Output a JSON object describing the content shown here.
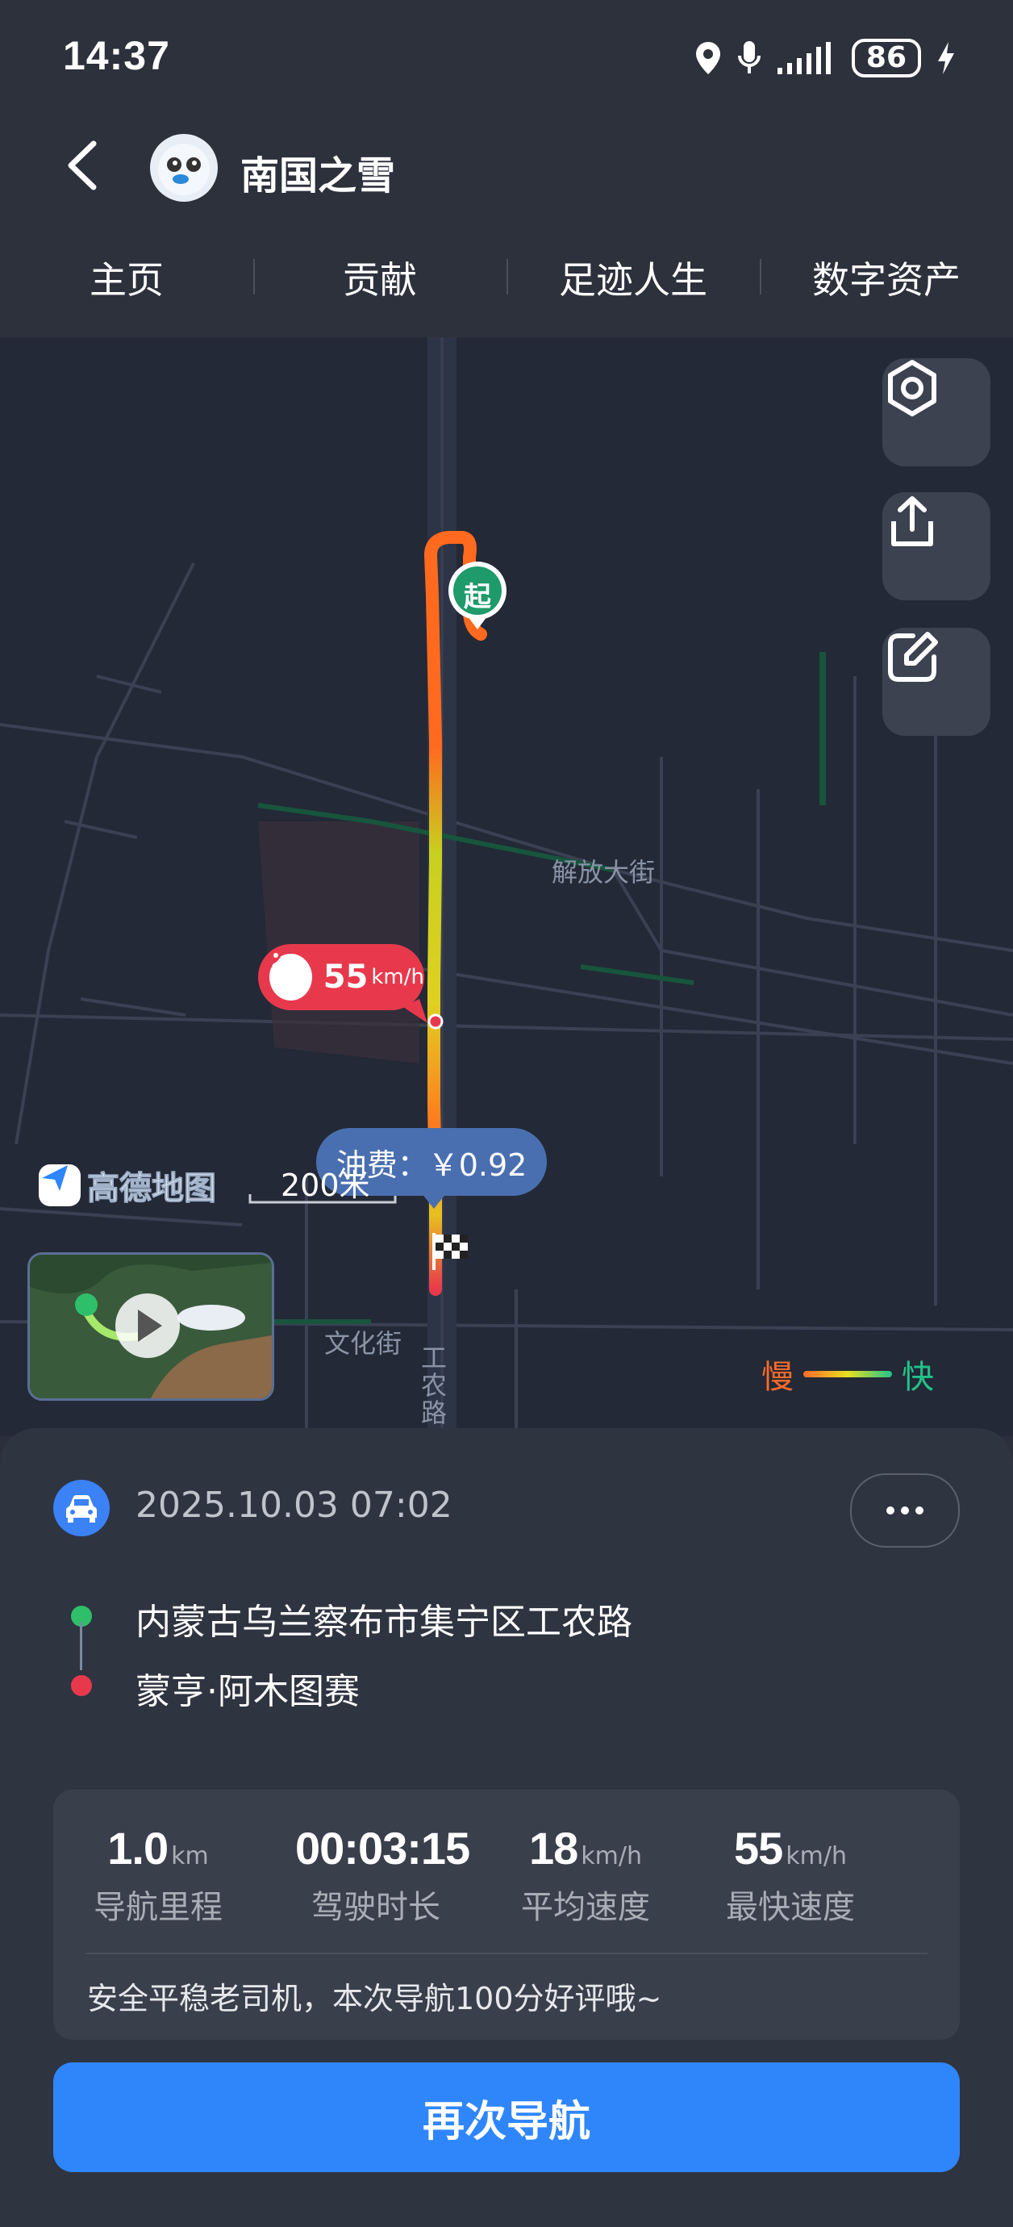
{
  "status": {
    "time": "14:37",
    "battery": "86"
  },
  "header": {
    "username": "南国之雪"
  },
  "tabs": [
    "主页",
    "贡献",
    "足迹人生",
    "数字资产"
  ],
  "map": {
    "street_label_1": "解放大街",
    "street_label_2": "文化街",
    "street_label_3": "工农路",
    "start_marker": "起",
    "speed_value": "55",
    "speed_unit": "km/h",
    "fee_text": "油费：￥0.92",
    "scale_text": "200米",
    "logo_text": "高德地图",
    "legend_slow": "慢",
    "legend_fast": "快",
    "colors": {
      "slow": "#ff6a2a",
      "mid": "#e8e020",
      "fast": "#22c28a"
    }
  },
  "trip": {
    "datetime": "2025.10.03 07:02",
    "origin": "内蒙古乌兰察布市集宁区工农路",
    "destination": "蒙亨·阿木图赛",
    "stats": [
      {
        "value": "1.0",
        "unit": "km",
        "label": "导航里程"
      },
      {
        "value": "00:03:15",
        "unit": "",
        "label": "驾驶时长"
      },
      {
        "value": "18",
        "unit": "km/h",
        "label": "平均速度"
      },
      {
        "value": "55",
        "unit": "km/h",
        "label": "最快速度"
      }
    ],
    "comment": "安全平稳老司机，本次导航100分好评哦~",
    "renav_label": "再次导航"
  },
  "icons": [
    "back-icon",
    "location-icon",
    "mic-icon",
    "signal-icon",
    "charging-icon",
    "settings-icon",
    "share-icon",
    "edit-icon",
    "rocket-icon",
    "finish-flag-icon",
    "play-icon",
    "car-icon",
    "more-icon"
  ]
}
